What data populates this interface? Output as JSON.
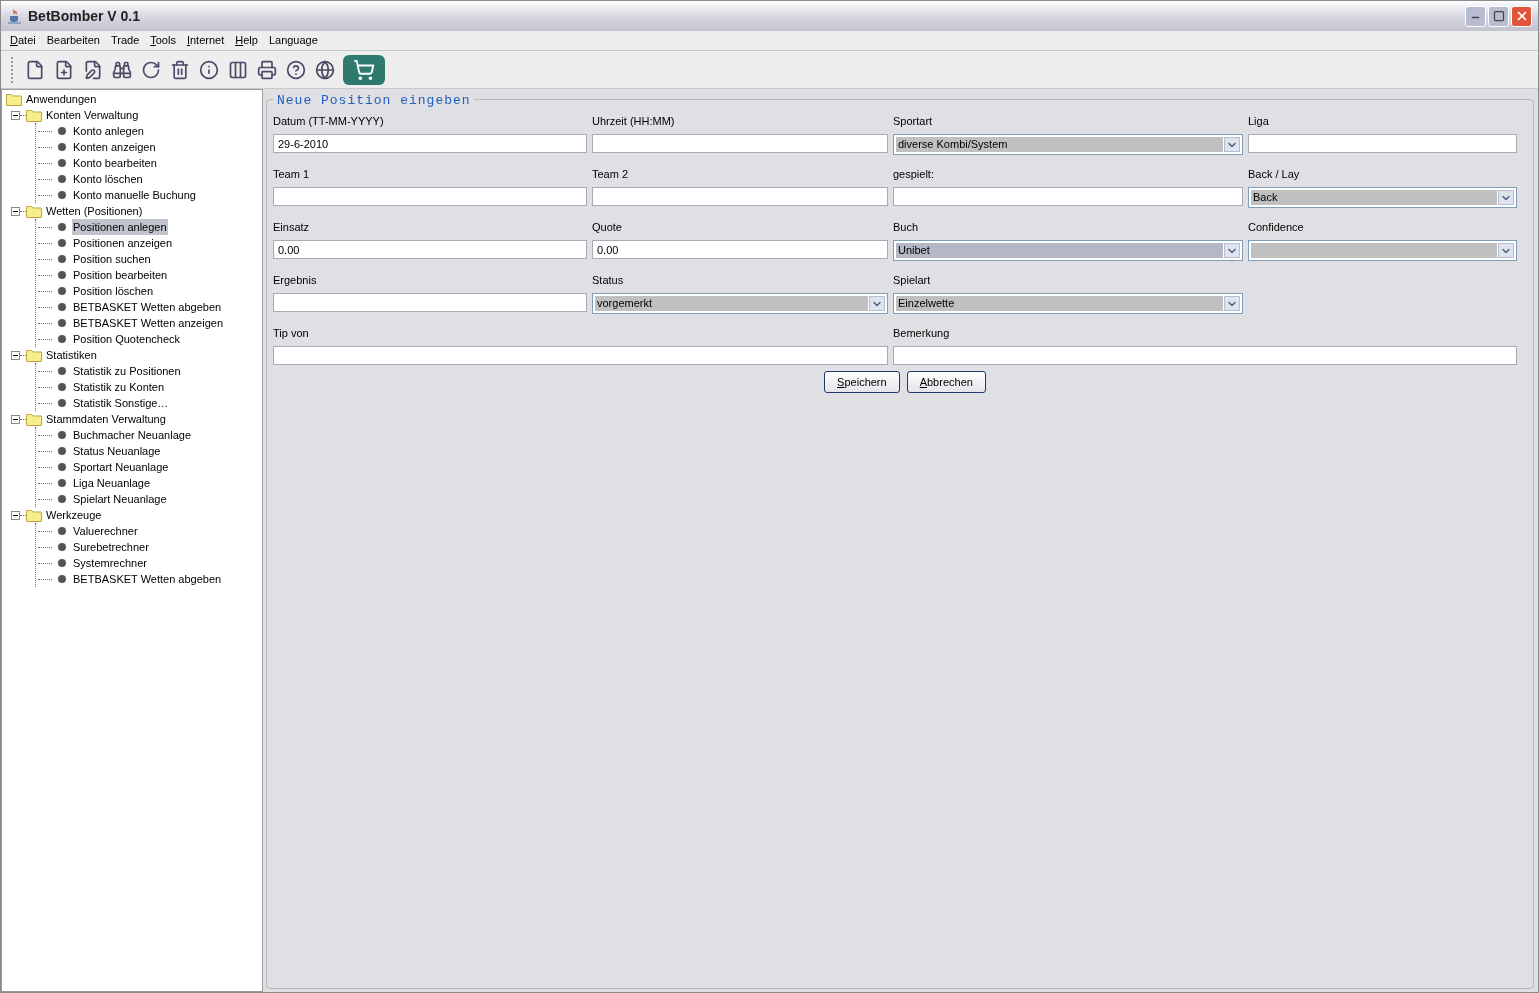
{
  "window": {
    "title": "BetBomber V 0.1"
  },
  "menu": [
    {
      "label": "Datei",
      "mnemonic": true
    },
    {
      "label": "Bearbeiten",
      "mnemonic": false
    },
    {
      "label": "Trade",
      "mnemonic": false
    },
    {
      "label": "Tools",
      "mnemonic": true
    },
    {
      "label": "Internet",
      "mnemonic": true
    },
    {
      "label": "Help",
      "mnemonic": true
    },
    {
      "label": "Language",
      "mnemonic": false
    }
  ],
  "tree": {
    "label": "Anwendungen",
    "children": [
      {
        "label": "Konten Verwaltung",
        "expanded": true,
        "children": [
          {
            "label": "Konto anlegen",
            "selected": false
          },
          {
            "label": "Konten anzeigen",
            "selected": false
          },
          {
            "label": "Konto bearbeiten",
            "selected": false
          },
          {
            "label": "Konto löschen",
            "selected": false
          },
          {
            "label": "Konto manuelle Buchung",
            "selected": false
          }
        ]
      },
      {
        "label": "Wetten (Positionen)",
        "expanded": true,
        "children": [
          {
            "label": "Positionen anlegen",
            "selected": true
          },
          {
            "label": "Positionen anzeigen",
            "selected": false
          },
          {
            "label": "Position suchen",
            "selected": false
          },
          {
            "label": "Position bearbeiten",
            "selected": false
          },
          {
            "label": "Position löschen",
            "selected": false
          },
          {
            "label": "BETBASKET Wetten abgeben",
            "selected": false
          },
          {
            "label": "BETBASKET Wetten anzeigen",
            "selected": false
          },
          {
            "label": "Position Quotencheck",
            "selected": false
          }
        ]
      },
      {
        "label": "Statistiken",
        "expanded": true,
        "children": [
          {
            "label": "Statistik zu Positionen",
            "selected": false
          },
          {
            "label": "Statistik zu Konten",
            "selected": false
          },
          {
            "label": "Statistik Sonstige…",
            "selected": false
          }
        ]
      },
      {
        "label": "Stammdaten Verwaltung",
        "expanded": true,
        "children": [
          {
            "label": "Buchmacher Neuanlage",
            "selected": false
          },
          {
            "label": "Status Neuanlage",
            "selected": false
          },
          {
            "label": "Sportart Neuanlage",
            "selected": false
          },
          {
            "label": "Liga Neuanlage",
            "selected": false
          },
          {
            "label": "Spielart Neuanlage",
            "selected": false
          }
        ]
      },
      {
        "label": "Werkzeuge",
        "expanded": true,
        "children": [
          {
            "label": "Valuerechner",
            "selected": false
          },
          {
            "label": "Surebetrechner",
            "selected": false
          },
          {
            "label": "Systemrechner",
            "selected": false
          },
          {
            "label": "BETBASKET Wetten abgeben",
            "selected": false
          }
        ]
      }
    ]
  },
  "form": {
    "title": "Neue Position eingeben",
    "rows": [
      [
        {
          "label": "Datum (TT-MM-YYYY)",
          "kind": "text",
          "value": "29-6-2010"
        },
        {
          "label": "Uhrzeit (HH:MM)",
          "kind": "text"
        },
        {
          "label": "Sportart",
          "kind": "select",
          "value": "diverse Kombi/System",
          "focused": false
        },
        {
          "label": "Liga",
          "kind": "text"
        }
      ],
      [
        {
          "label": "Team 1",
          "kind": "text"
        },
        {
          "label": "Team 2",
          "kind": "text"
        },
        {
          "label": "gespielt:",
          "kind": "text"
        },
        {
          "label": "Back / Lay",
          "kind": "select",
          "value": "Back",
          "focused": false
        }
      ],
      [
        {
          "label": "Einsatz",
          "kind": "text",
          "value": "0.00"
        },
        {
          "label": "Quote",
          "kind": "text",
          "value": "0.00"
        },
        {
          "label": "Buch",
          "kind": "select",
          "value": "Unibet",
          "focused": true
        },
        {
          "label": "Confidence",
          "kind": "select",
          "focused": false
        }
      ],
      [
        {
          "label": "Ergebnis",
          "kind": "text"
        },
        {
          "label": "Status",
          "kind": "select",
          "value": "vorgemerkt",
          "focused": false
        },
        {
          "label": "Spielart",
          "kind": "select",
          "value": "Einzelwette",
          "focused": false
        }
      ]
    ],
    "wide_row": [
      {
        "label": "Tip von",
        "kind": "text"
      },
      {
        "label": "Bemerkung",
        "kind": "text"
      }
    ],
    "buttons": [
      {
        "label": "Speichern",
        "mnemonic": true
      },
      {
        "label": "Abbrechen",
        "mnemonic": true
      }
    ]
  }
}
